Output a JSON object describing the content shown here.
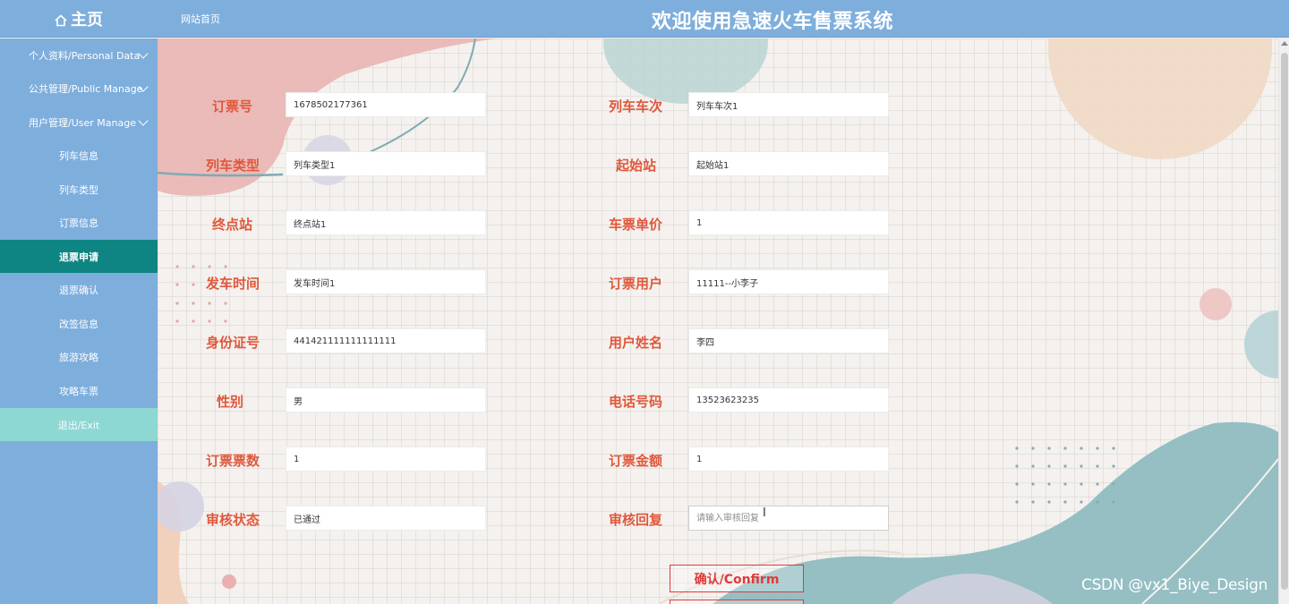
{
  "header": {
    "home_label": "主页",
    "site_link": "网站首页",
    "title": "欢迎使用急速火车售票系统"
  },
  "sidebar": {
    "items": [
      {
        "label": "个人资料/Personal Data",
        "type": "group"
      },
      {
        "label": "公共管理/Public Manage",
        "type": "group"
      },
      {
        "label": "用户管理/User Manage",
        "type": "group"
      },
      {
        "label": "列车信息",
        "type": "link"
      },
      {
        "label": "列车类型",
        "type": "link"
      },
      {
        "label": "订票信息",
        "type": "link"
      },
      {
        "label": "退票申请",
        "type": "active"
      },
      {
        "label": "退票确认",
        "type": "link"
      },
      {
        "label": "改签信息",
        "type": "link"
      },
      {
        "label": "旅游攻略",
        "type": "link"
      },
      {
        "label": "攻略车票",
        "type": "link"
      },
      {
        "label": "退出/Exit",
        "type": "exit"
      }
    ]
  },
  "form": {
    "order_no": {
      "label": "订票号",
      "value": "1678502177361"
    },
    "train_no": {
      "label": "列车车次",
      "value": "列车车次1"
    },
    "train_type": {
      "label": "列车类型",
      "value": "列车类型1"
    },
    "start_station": {
      "label": "起始站",
      "value": "起始站1"
    },
    "end_station": {
      "label": "终点站",
      "value": "终点站1"
    },
    "ticket_price": {
      "label": "车票单价",
      "value": "1"
    },
    "depart_time": {
      "label": "发车时间",
      "value": "发车时间1"
    },
    "order_user": {
      "label": "订票用户",
      "value": "11111--小李子"
    },
    "id_card": {
      "label": "身份证号",
      "value": "441421111111111111"
    },
    "user_name": {
      "label": "用户姓名",
      "value": "李四"
    },
    "gender": {
      "label": "性别",
      "value": "男"
    },
    "phone": {
      "label": "电话号码",
      "value": "13523623235"
    },
    "ticket_count": {
      "label": "订票票数",
      "value": "1"
    },
    "order_amount": {
      "label": "订票金额",
      "value": "1"
    },
    "review_status": {
      "label": "审核状态",
      "value": "已通过"
    },
    "review_reply": {
      "label": "审核回复",
      "value": "",
      "placeholder": "请输入审核回复"
    }
  },
  "buttons": {
    "confirm": "确认/Confirm"
  },
  "watermark": "CSDN @vx1_Biye_Design",
  "colors": {
    "sidebar_bg": "#7eaedc",
    "active_item": "#0e8582",
    "exit_item": "#8ed8d4",
    "label_color": "#e0583c",
    "button_color": "#e03a3a"
  }
}
